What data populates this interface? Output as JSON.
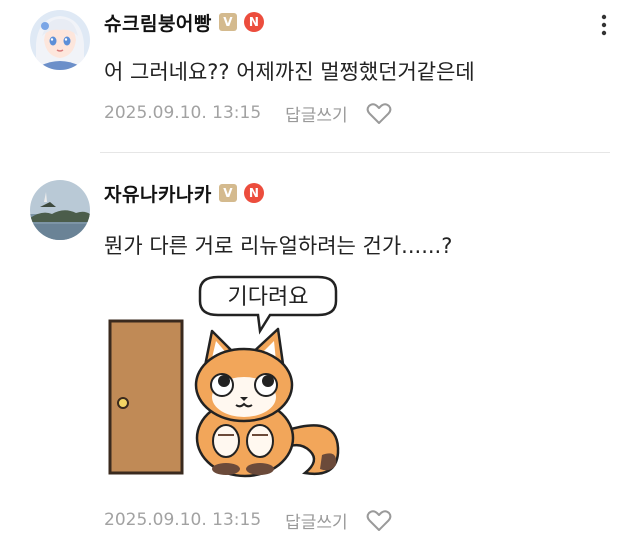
{
  "comments": [
    {
      "username": "슈크림붕어빵",
      "badge_v": "V",
      "badge_n": "N",
      "text": "어 그러네요?? 어제까진 멀쩡했던거같은데",
      "timestamp": "2025.09.10. 13:15",
      "reply_label": "답글쓰기",
      "avatar": "anime-girl-avatar"
    },
    {
      "username": "자유나카나카",
      "badge_v": "V",
      "badge_n": "N",
      "text": "뭔가 다른 거로 리뉴얼하려는 건가......?",
      "sticker_text": "기다려요",
      "timestamp": "2025.09.10. 13:15",
      "reply_label": "답글쓰기",
      "avatar": "landscape-avatar"
    }
  ],
  "icons": {
    "more": "more-vertical-icon",
    "like": "heart-outline-icon"
  },
  "colors": {
    "badge_v": "#d4ba8e",
    "badge_n": "#ec4d3d",
    "meta_text": "#a2a2a2",
    "sticker_orange": "#f2a65a",
    "door_brown": "#c08a56"
  }
}
